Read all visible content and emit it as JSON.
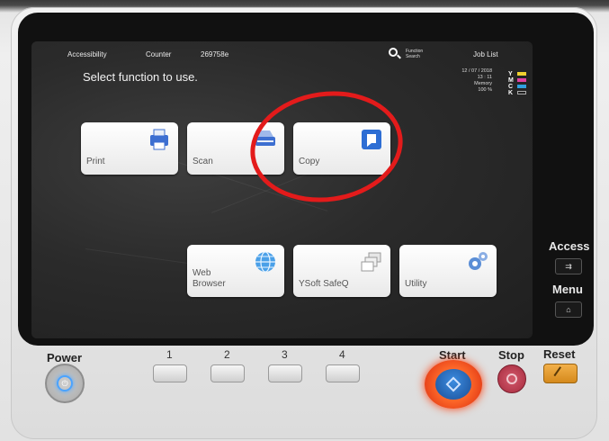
{
  "topbar": {
    "accessibility": "Accessibility",
    "counter": "Counter",
    "counter_value": "269758e",
    "function_search": "Function Search",
    "job_list": "Job List"
  },
  "prompt": "Select function to use.",
  "status": {
    "date": "12 / 07 / 2018",
    "time": "13 : 11",
    "memory_label": "Memory",
    "memory_value": "100 %"
  },
  "toner": [
    {
      "letter": "Y",
      "color": "#f0d030"
    },
    {
      "letter": "M",
      "color": "#e040a0"
    },
    {
      "letter": "C",
      "color": "#30a0e0"
    },
    {
      "letter": "K",
      "color": "#202020"
    }
  ],
  "tiles": {
    "print": "Print",
    "scan": "Scan",
    "copy": "Copy",
    "web_browser_1": "Web",
    "web_browser_2": "Browser",
    "ysoft": "YSoft SafeQ",
    "utility": "Utility"
  },
  "side": {
    "access": "Access",
    "menu": "Menu"
  },
  "panel": {
    "power": "Power",
    "numbers": [
      "1",
      "2",
      "3",
      "4"
    ],
    "start": "Start",
    "stop": "Stop",
    "reset": "Reset"
  },
  "colors": {
    "highlight_ring": "#e31b1b",
    "start_ring": "#ff4010",
    "start_core": "#1a4e96",
    "stop": "#a52a3e",
    "reset": "#d58a1c"
  }
}
